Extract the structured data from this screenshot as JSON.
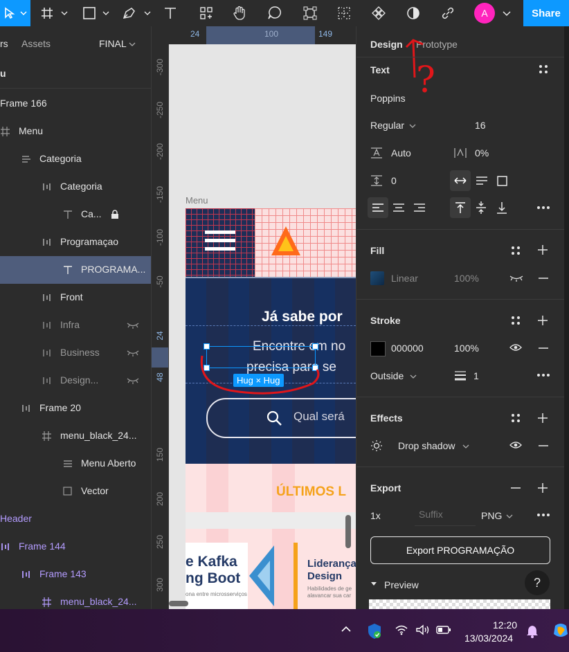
{
  "toolbar": {
    "share_label": "Share",
    "avatar_letter": "A"
  },
  "left_panel": {
    "tab_layers": "rs",
    "tab_assets": "Assets",
    "page_name": "FINAL",
    "page_item_partial": "u",
    "layers": [
      {
        "label": "Frame 166"
      },
      {
        "label": "Menu"
      },
      {
        "label": "Categoria"
      },
      {
        "label": "Categoria"
      },
      {
        "label": "Ca..."
      },
      {
        "label": "Programaçao"
      },
      {
        "label": "PROGRAMA..."
      },
      {
        "label": "Front"
      },
      {
        "label": "Infra"
      },
      {
        "label": "Business"
      },
      {
        "label": "Design..."
      },
      {
        "label": "Frame 20"
      },
      {
        "label": "menu_black_24..."
      },
      {
        "label": "Menu Aberto"
      },
      {
        "label": "Vector"
      },
      {
        "label": "Header"
      },
      {
        "label": "Frame 144"
      },
      {
        "label": "Frame 143"
      },
      {
        "label": "menu_black_24..."
      }
    ]
  },
  "rulers": {
    "h": [
      "24",
      "100",
      "149"
    ],
    "v": [
      "-300",
      "-250",
      "-200",
      "-150",
      "-100",
      "-50",
      "24",
      "48",
      "150",
      "200",
      "250",
      "300"
    ]
  },
  "canvas": {
    "frame_label": "Menu",
    "heading": "Já sabe por",
    "body_line1": "Encontre em no",
    "body_line2": "precisa para se",
    "hug_badge": "Hug × Hug",
    "search_text": "Qual será",
    "section_title": "ÚLTIMOS L",
    "card1_line1": "e Kafka",
    "card1_line2": "ng Boot",
    "card1_small": "ona entre microsserviços",
    "card2_line1": "Liderança",
    "card2_line2": "Design",
    "card2_small1": "Habilidades de ge",
    "card2_small2": "alavancar sua car"
  },
  "right_panel": {
    "tab_design": "Design",
    "tab_prototype": "Prototype",
    "text_section": "Text",
    "font_family": "Poppins",
    "font_weight": "Regular",
    "font_size": "16",
    "line_height": "Auto",
    "letter_spacing": "0%",
    "paragraph_spacing": "0",
    "fill_section": "Fill",
    "fill_type": "Linear",
    "fill_opacity": "100%",
    "stroke_section": "Stroke",
    "stroke_hex": "000000",
    "stroke_opacity": "100%",
    "stroke_position": "Outside",
    "stroke_weight": "1",
    "effects_section": "Effects",
    "effect_name": "Drop shadow",
    "export_section": "Export",
    "export_scale": "1x",
    "export_suffix_placeholder": "Suffix",
    "export_format": "PNG",
    "export_button": "Export PROGRAMAÇÃO",
    "preview_label": "Preview",
    "help": "?",
    "annotation": "?"
  },
  "taskbar": {
    "time": "12:20",
    "date": "13/03/2024"
  },
  "colors": {
    "accent": "#0d99ff",
    "selection": "#4f5d7c",
    "annotation": "#e0161a",
    "avatar": "#ff24bd"
  }
}
